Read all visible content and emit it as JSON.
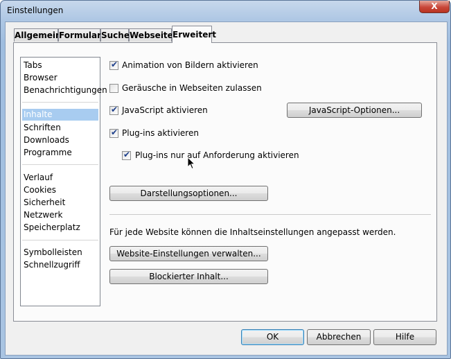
{
  "window": {
    "title": "Einstellungen",
    "close_glyph": "X"
  },
  "tabs": [
    {
      "label": "Allgemein"
    },
    {
      "label": "Formulare"
    },
    {
      "label": "Suche"
    },
    {
      "label": "Webseiten"
    },
    {
      "label": "Erweitert",
      "active": true
    }
  ],
  "sidebar": {
    "groups": [
      [
        "Tabs",
        "Browser",
        "Benachrichtigungen"
      ],
      [
        "Inhalte",
        "Schriften",
        "Downloads",
        "Programme"
      ],
      [
        "Verlauf",
        "Cookies",
        "Sicherheit",
        "Netzwerk",
        "Speicherplatz"
      ],
      [
        "Symbolleisten",
        "Schnellzugriff"
      ]
    ],
    "selected": "Inhalte"
  },
  "options": {
    "animation": {
      "label": "Animation von Bildern aktivieren",
      "checked": true
    },
    "sounds": {
      "label": "Geräusche in Webseiten zulassen",
      "checked": false
    },
    "javascript": {
      "label": "JavaScript aktivieren",
      "checked": true
    },
    "plugins": {
      "label": "Plug-ins aktivieren",
      "checked": true
    },
    "plugins_on_demand": {
      "label": "Plug-ins nur auf Anforderung aktivieren",
      "checked": true
    }
  },
  "buttons": {
    "js_options": "JavaScript-Optionen...",
    "display_options": "Darstellungsoptionen...",
    "site_prefs": "Website-Einstellungen verwalten...",
    "blocked": "Blockierter Inhalt...",
    "ok": "OK",
    "cancel": "Abbrechen",
    "help": "Hilfe"
  },
  "info_text": "Für jede Website können die Inhaltseinstellungen angepasst werden."
}
